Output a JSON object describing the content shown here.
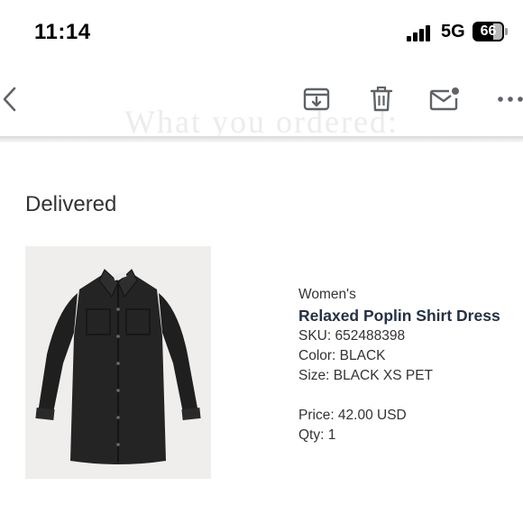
{
  "status_bar": {
    "time": "11:14",
    "network": "5G",
    "battery": "66"
  },
  "toolbar": {
    "back_icon": "chevron-left-icon",
    "archive_icon": "archive-icon",
    "trash_icon": "trash-icon",
    "mail_icon": "unread-mail-icon",
    "more_icon": "more-icon"
  },
  "email": {
    "faded_heading": "What you ordered:",
    "order_status": "Delivered",
    "item": {
      "gender": "Women's",
      "name": "Relaxed Poplin Shirt Dress",
      "sku": "SKU: 652488398",
      "color": "Color: BLACK",
      "size": "Size: BLACK XS PET",
      "price": "Price: 42.00 USD",
      "qty": "Qty: 1"
    }
  }
}
